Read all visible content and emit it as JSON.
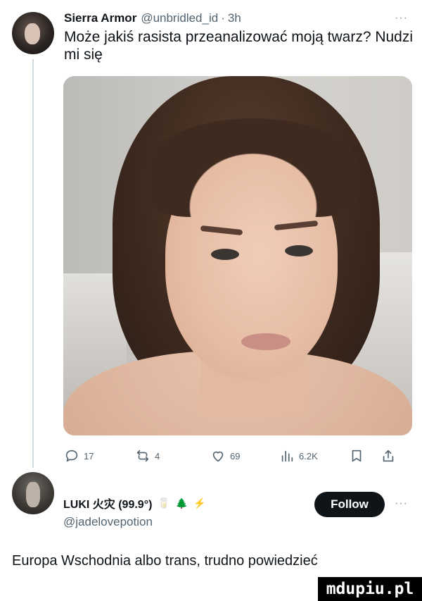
{
  "tweet": {
    "author_name": "Sierra Armor",
    "handle": "@unbridled_id",
    "separator": "·",
    "time": "3h",
    "more": "···",
    "text": "Może jakiś rasista przeanalizować moją twarz? Nudzi mi się",
    "media": "photo of a person",
    "actions": {
      "reply_count": "17",
      "retweet_count": "4",
      "like_count": "69",
      "views_count": "6.2K"
    }
  },
  "reply": {
    "author_name": "LUKI 火灾 (99.9°)",
    "badges": [
      "🥛",
      "🌲",
      "⚡"
    ],
    "handle": "@jadelovepotion",
    "follow_label": "Follow",
    "more": "···",
    "text": "Europa Wschodnia albo trans, trudno powiedzieć"
  },
  "watermark": "mdupiu.pl"
}
